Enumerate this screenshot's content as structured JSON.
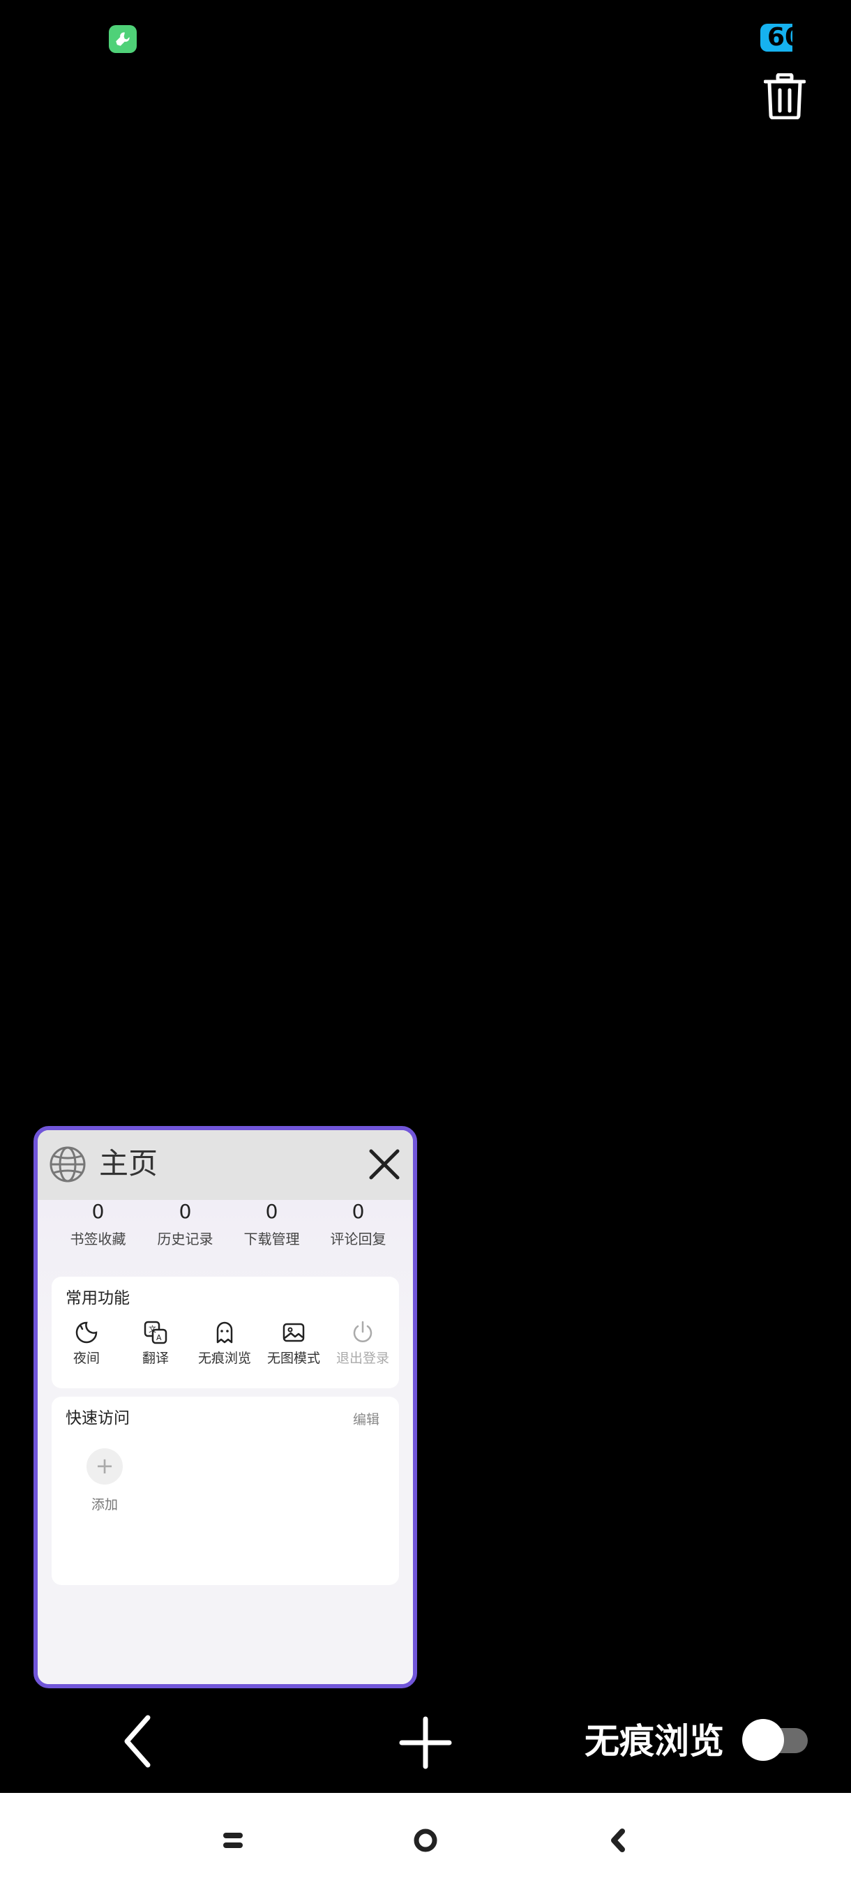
{
  "status_bar": {
    "app_icon": "wrench-icon",
    "badge_text": "60"
  },
  "toolbar_top": {
    "trash_icon": "trash-icon"
  },
  "tab_card": {
    "title": "主页",
    "stats": [
      {
        "count": "0",
        "label": "书签收藏"
      },
      {
        "count": "0",
        "label": "历史记录"
      },
      {
        "count": "0",
        "label": "下载管理"
      },
      {
        "count": "0",
        "label": "评论回复"
      }
    ],
    "common_functions": {
      "title": "常用功能",
      "items": [
        {
          "label": "夜间",
          "icon": "moon-icon"
        },
        {
          "label": "翻译",
          "icon": "translate-icon"
        },
        {
          "label": "无痕浏览",
          "icon": "ghost-icon"
        },
        {
          "label": "无图模式",
          "icon": "image-icon"
        },
        {
          "label": "退出登录",
          "icon": "power-icon"
        }
      ]
    },
    "quick_access": {
      "title": "快速访问",
      "edit_label": "编辑",
      "add_label": "添加",
      "add_symbol": "+"
    }
  },
  "bottom_toolbar": {
    "incognito_label": "无痕浏览",
    "incognito_enabled": false
  },
  "colors": {
    "card_border": "#7156d9",
    "badge": "#16b2f0",
    "app_icon": "#4fd178"
  }
}
